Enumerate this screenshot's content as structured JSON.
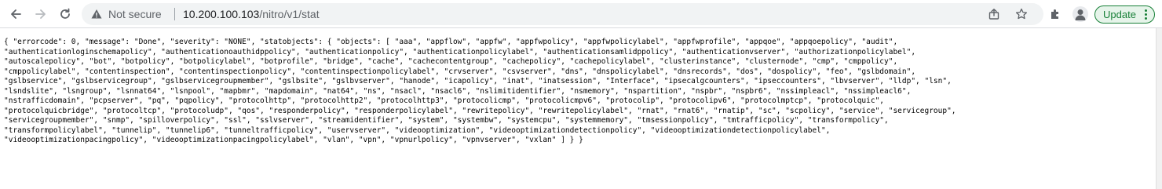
{
  "browser": {
    "back_icon": "arrow-left-icon",
    "forward_icon": "arrow-right-icon",
    "reload_icon": "reload-icon",
    "security_icon": "warning-triangle-icon",
    "security_label": "Not secure",
    "url_host": "10.200.100.103",
    "url_path": "/nitro/v1/stat",
    "share_icon": "share-icon",
    "bookmark_icon": "star-icon",
    "extensions_icon": "puzzle-icon",
    "profile_icon": "avatar-icon",
    "update_label": "Update",
    "menu_icon": "kebab-menu-icon",
    "accent_color": "#188038"
  },
  "page": {
    "json_lines": [
      "{ \"errorcode\": 0, \"message\": \"Done\", \"severity\": \"NONE\", \"statobjects\": { \"objects\": [ \"aaa\", \"appflow\", \"appfw\", \"appfwpolicy\", \"appfwpolicylabel\", \"appfwprofile\", \"appqoe\", \"appqoepolicy\", \"audit\",",
      "\"authenticationloginschemapolicy\", \"authenticationoauthidppolicy\", \"authenticationpolicy\", \"authenticationpolicylabel\", \"authenticationsamlidppolicy\", \"authenticationvserver\", \"authorizationpolicylabel\",",
      "\"autoscalepolicy\", \"bot\", \"botpolicy\", \"botpolicylabel\", \"botprofile\", \"bridge\", \"cache\", \"cachecontentgroup\", \"cachepolicy\", \"cachepolicylabel\", \"clusterinstance\", \"clusternode\", \"cmp\", \"cmppolicy\",",
      "\"cmppolicylabel\", \"contentinspection\", \"contentinspectionpolicy\", \"contentinspectionpolicylabel\", \"crvserver\", \"csvserver\", \"dns\", \"dnspolicylabel\", \"dnsrecords\", \"dos\", \"dospolicy\", \"feo\", \"gslbdomain\",",
      "\"gslbservice\", \"gslbservicegroup\", \"gslbservicegroupmember\", \"gslbsite\", \"gslbvserver\", \"hanode\", \"icapolicy\", \"inat\", \"inatsession\", \"Interface\", \"ipsecalgcounters\", \"ipseccounters\", \"lbvserver\", \"lldp\", \"lsn\",",
      "\"lsndslite\", \"lsngroup\", \"lsnnat64\", \"lsnpool\", \"mapbmr\", \"mapdomain\", \"nat64\", \"ns\", \"nsacl\", \"nsacl6\", \"nslimitidentifier\", \"nsmemory\", \"nspartition\", \"nspbr\", \"nspbr6\", \"nssimpleacl\", \"nssimpleacl6\",",
      "\"nstrafficdomain\", \"pcpserver\", \"pq\", \"pqpolicy\", \"protocolhttp\", \"protocolhttp2\", \"protocolhttp3\", \"protocolicmp\", \"protocolicmpv6\", \"protocolip\", \"protocolipv6\", \"protocolmptcp\", \"protocolquic\",",
      "\"protocolquicbridge\", \"protocoltcp\", \"protocoludp\", \"qos\", \"responderpolicy\", \"responderpolicylabel\", \"rewritepolicy\", \"rewritepolicylabel\", \"rnat\", \"rnat6\", \"rnatip\", \"sc\", \"scpolicy\", \"service\", \"servicegroup\",",
      "\"servicegroupmember\", \"snmp\", \"spilloverpolicy\", \"ssl\", \"sslvserver\", \"streamidentifier\", \"system\", \"systembw\", \"systemcpu\", \"systemmemory\", \"tmsessionpolicy\", \"tmtrafficpolicy\", \"transformpolicy\",",
      "\"transformpolicylabel\", \"tunnelip\", \"tunnelip6\", \"tunneltrafficpolicy\", \"uservserver\", \"videooptimization\", \"videooptimizationdetectionpolicy\", \"videooptimizationdetectionpolicylabel\",",
      "\"videooptimizationpacingpolicy\", \"videooptimizationpacingpolicylabel\", \"vlan\", \"vpn\", \"vpnurlpolicy\", \"vpnvserver\", \"vxlan\" ] } }"
    ]
  }
}
